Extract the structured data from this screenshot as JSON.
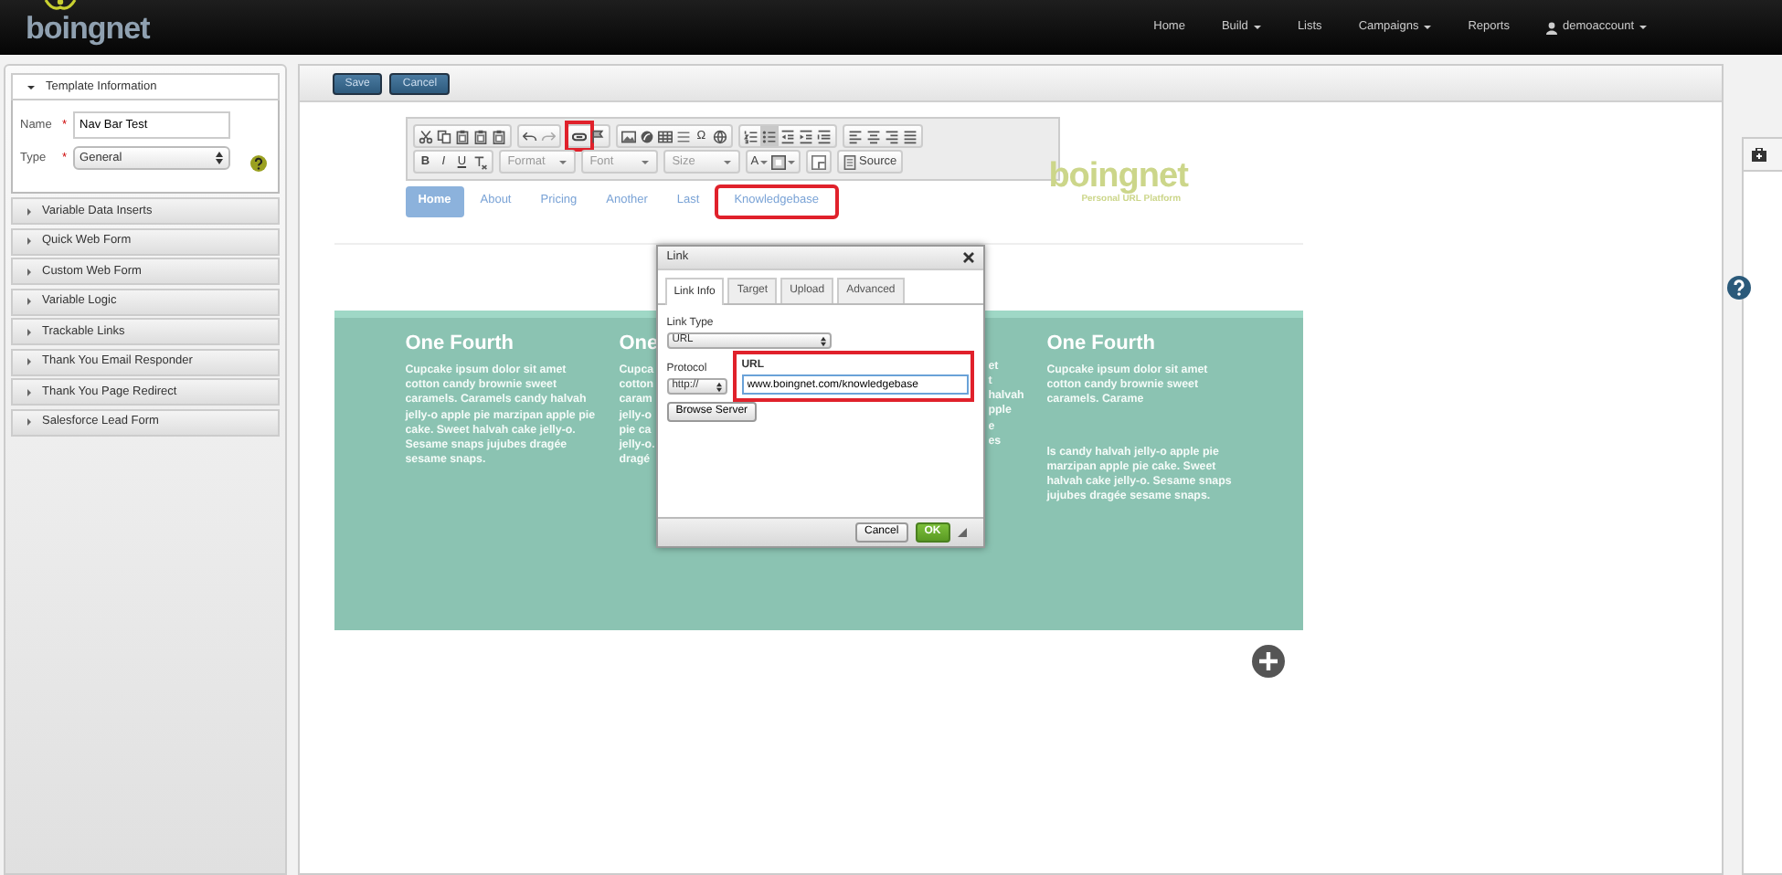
{
  "navbar": {
    "logo": "boingnet",
    "items": [
      {
        "label": "Home",
        "dropdown": false
      },
      {
        "label": "Build",
        "dropdown": true
      },
      {
        "label": "Lists",
        "dropdown": false
      },
      {
        "label": "Campaigns",
        "dropdown": true
      },
      {
        "label": "Reports",
        "dropdown": false
      }
    ],
    "account": {
      "label": "demoaccount",
      "dropdown": true
    }
  },
  "sidebar": {
    "sections": [
      {
        "title": "Template Information",
        "expanded": true,
        "fields": [
          {
            "kind": "text",
            "label": "Name",
            "required_mark": "*",
            "value": "Nav Bar Test"
          },
          {
            "kind": "select",
            "label": "Type",
            "required_mark": "*",
            "value": "General"
          }
        ]
      },
      {
        "title": "Variable Data Inserts",
        "expanded": false
      },
      {
        "title": "Quick Web Form",
        "expanded": false
      },
      {
        "title": "Custom Web Form",
        "expanded": false
      },
      {
        "title": "Variable Logic",
        "expanded": false
      },
      {
        "title": "Trackable Links",
        "expanded": false
      },
      {
        "title": "Thank You Email Responder",
        "expanded": false
      },
      {
        "title": "Thank You Page Redirect",
        "expanded": false
      },
      {
        "title": "Salesforce Lead Form",
        "expanded": false
      }
    ]
  },
  "actions": [
    {
      "label": "Save"
    },
    {
      "label": "Cancel"
    }
  ],
  "editor_toolbar": {
    "rows": [
      [
        [
          {
            "kind": "cut",
            "active": false,
            "highlighted": false
          },
          {
            "kind": "copy",
            "active": false,
            "highlighted": false
          },
          {
            "kind": "paste",
            "active": false,
            "highlighted": false
          },
          {
            "kind": "paste",
            "active": false,
            "highlighted": false
          },
          {
            "kind": "paste",
            "active": false,
            "highlighted": false
          }
        ],
        [
          {
            "kind": "undo",
            "active": false,
            "highlighted": false
          },
          {
            "kind": "redo",
            "active": false,
            "highlighted": false
          }
        ],
        [
          {
            "kind": "link",
            "active": false,
            "highlighted": true
          },
          {
            "kind": "anchor",
            "active": false,
            "highlighted": false
          }
        ],
        [
          {
            "kind": "image",
            "active": false,
            "highlighted": false
          },
          {
            "kind": "flash",
            "active": false,
            "highlighted": false
          },
          {
            "kind": "table",
            "active": false,
            "highlighted": false
          },
          {
            "kind": "rule",
            "active": false,
            "highlighted": false
          },
          {
            "kind": "char",
            "label": "Ω",
            "active": false,
            "highlighted": false
          },
          {
            "kind": "iframe",
            "active": false,
            "highlighted": false
          }
        ],
        [
          {
            "kind": "numbered-list",
            "active": false,
            "highlighted": false
          },
          {
            "kind": "bulleted-list",
            "active": true,
            "highlighted": false
          },
          {
            "kind": "outdent",
            "active": false,
            "highlighted": false
          },
          {
            "kind": "indent",
            "active": false,
            "highlighted": false
          },
          {
            "kind": "blockquote",
            "active": false,
            "highlighted": false
          }
        ],
        [
          {
            "kind": "align-left",
            "active": false,
            "highlighted": false
          },
          {
            "kind": "align-center",
            "active": false,
            "highlighted": false
          },
          {
            "kind": "align-right",
            "active": false,
            "highlighted": false
          },
          {
            "kind": "justify",
            "active": false,
            "highlighted": false
          }
        ]
      ],
      [
        [
          {
            "kind": "bold",
            "label": "B"
          },
          {
            "kind": "italic",
            "label": "I"
          },
          {
            "kind": "underline",
            "label": "U"
          },
          {
            "kind": "remove-format"
          }
        ],
        [
          {
            "kind": "combo",
            "label": "Format"
          }
        ],
        [
          {
            "kind": "combo",
            "label": "Font"
          }
        ],
        [
          {
            "kind": "combo",
            "label": "Size"
          }
        ],
        [
          {
            "kind": "text-color",
            "label": "A"
          },
          {
            "kind": "bg-color"
          }
        ],
        [
          {
            "kind": "maximize"
          }
        ],
        [
          {
            "kind": "source",
            "label": "Source"
          }
        ]
      ]
    ]
  },
  "page_nav": [
    {
      "label": "Home",
      "selected": true,
      "highlighted": false
    },
    {
      "label": "About",
      "selected": false,
      "highlighted": false
    },
    {
      "label": "Pricing",
      "selected": false,
      "highlighted": false
    },
    {
      "label": "Another",
      "selected": false,
      "highlighted": false
    },
    {
      "label": "Last",
      "selected": false,
      "highlighted": false
    },
    {
      "label": "Knowledgebase",
      "selected": false,
      "highlighted": true
    }
  ],
  "page_logo": {
    "name": "boingnet",
    "tagline": "Personal URL Platform"
  },
  "columns": [
    {
      "title": "One Fourth",
      "paragraphs": [
        "Cupcake ipsum dolor sit amet cotton candy brownie sweet caramels. Caramels candy halvah jelly-o apple pie marzipan apple pie cake. Sweet halvah cake jelly-o. Sesame snaps jujubes dragée sesame snaps."
      ]
    },
    {
      "title": "One",
      "lines": [
        "Cupca",
        "cotton",
        "caram",
        "jelly-o",
        "pie ca",
        "jelly-o.",
        "dragé"
      ]
    },
    {
      "lines": [
        "et",
        "t",
        "halvah",
        "pple",
        "e",
        "es"
      ]
    },
    {
      "title": "One Fourth",
      "paragraphs": [
        "Cupcake ipsum dolor sit amet cotton candy brownie sweet caramels. Carame",
        "ls candy halvah jelly-o apple pie marzipan apple pie cake. Sweet halvah cake jelly-o. Sesame snaps jujubes dragée sesame snaps."
      ]
    }
  ],
  "dialog": {
    "title": "Link",
    "tabs": [
      {
        "label": "Link Info",
        "selected": true
      },
      {
        "label": "Target",
        "selected": false
      },
      {
        "label": "Upload",
        "selected": false
      },
      {
        "label": "Advanced",
        "selected": false
      }
    ],
    "link_type": {
      "label": "Link Type",
      "value": "URL"
    },
    "protocol": {
      "label": "Protocol",
      "value": "http://"
    },
    "url": {
      "label": "URL",
      "value": "www.boingnet.com/knowledgebase",
      "highlighted": true
    },
    "browse_button": "Browse Server",
    "buttons": [
      {
        "label": "Cancel",
        "primary": false
      },
      {
        "label": "OK",
        "primary": true
      }
    ]
  }
}
